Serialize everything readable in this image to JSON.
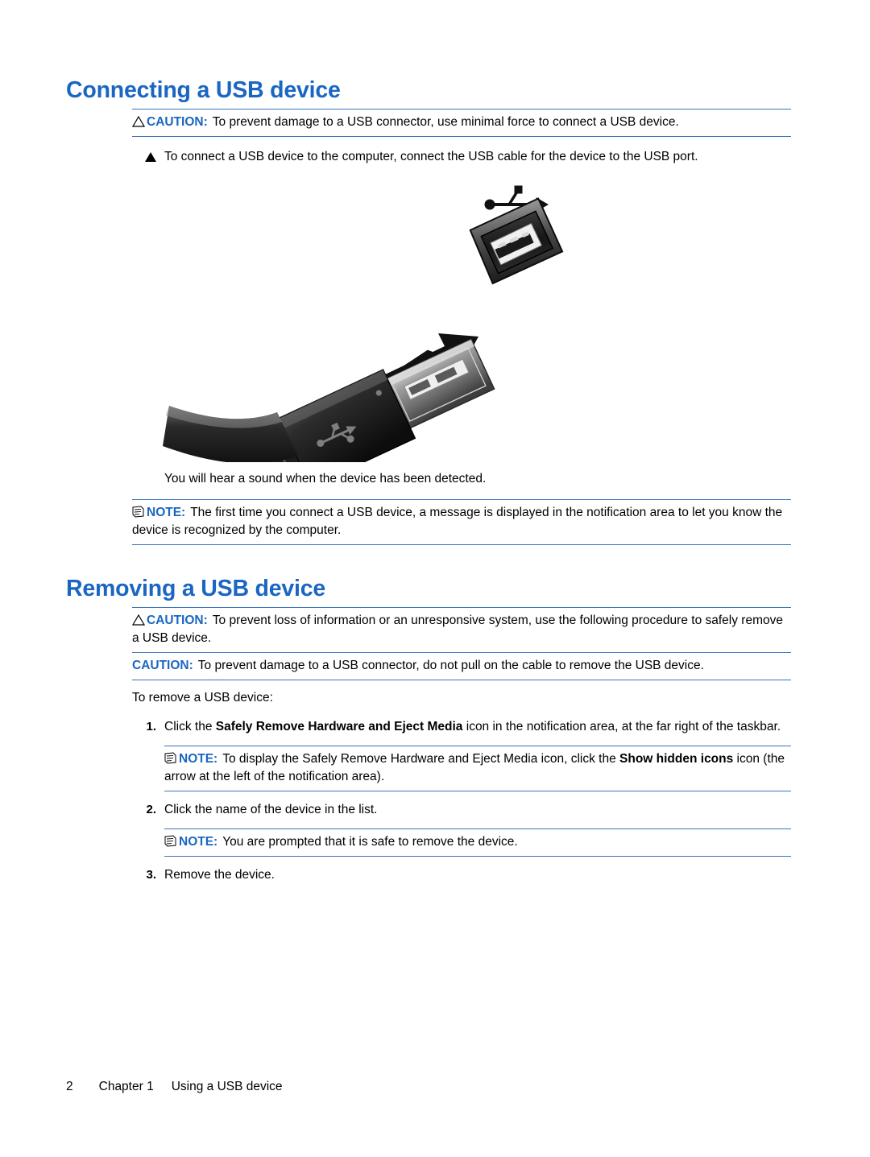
{
  "page": {
    "number": "2",
    "chapter": "Chapter 1",
    "chapter_title": "Using a USB device"
  },
  "sections": [
    {
      "title": "Connecting a USB device",
      "caution1": {
        "label": "CAUTION:",
        "text": "To prevent damage to a USB connector, use minimal force to connect a USB device."
      },
      "bullet1": "To connect a USB device to the computer, connect the USB cable for the device to the USB port.",
      "figure_caption": "",
      "after_figure": "You will hear a sound when the device has been detected.",
      "note1": {
        "label": "NOTE:",
        "text": "The first time you connect a USB device, a message is displayed in the notification area to let you know the device is recognized by the computer."
      }
    },
    {
      "title": "Removing a USB device",
      "caution1": {
        "label": "CAUTION:",
        "text": "To prevent loss of information or an unresponsive system, use the following procedure to safely remove a USB device."
      },
      "caution2": {
        "label": "CAUTION:",
        "text": "To prevent damage to a USB connector, do not pull on the cable to remove the USB device."
      },
      "lead_in": "To remove a USB device:",
      "steps": [
        {
          "number": "1.",
          "text_before": "Click the ",
          "bold": "Safely Remove Hardware and Eject Media",
          "text_after": " icon in the notification area, at the far right of the taskbar."
        },
        {
          "number": "2.",
          "text_before": "Click the name of the device in the list.",
          "bold": "",
          "text_after": ""
        },
        {
          "number": "3.",
          "text_before": "Remove the device.",
          "bold": "",
          "text_after": ""
        }
      ],
      "note1": {
        "label": "NOTE:",
        "text_before": "To display the Safely Remove Hardware and Eject Media icon, click the ",
        "bold": "Show hidden icons",
        "text_after": " icon (the arrow at the left of the notification area)."
      },
      "note2": {
        "label": "NOTE:",
        "text": "You are prompted that it is safe to remove the device."
      }
    }
  ],
  "figure": {
    "name": "usb-cable-connector-illustration",
    "alt": "Illustration of a USB cable plug being inserted into a USB port with a USB trident symbol above the port"
  },
  "colors": {
    "heading": "#1a66c2",
    "rule": "#3a74bb",
    "text": "#000000"
  }
}
